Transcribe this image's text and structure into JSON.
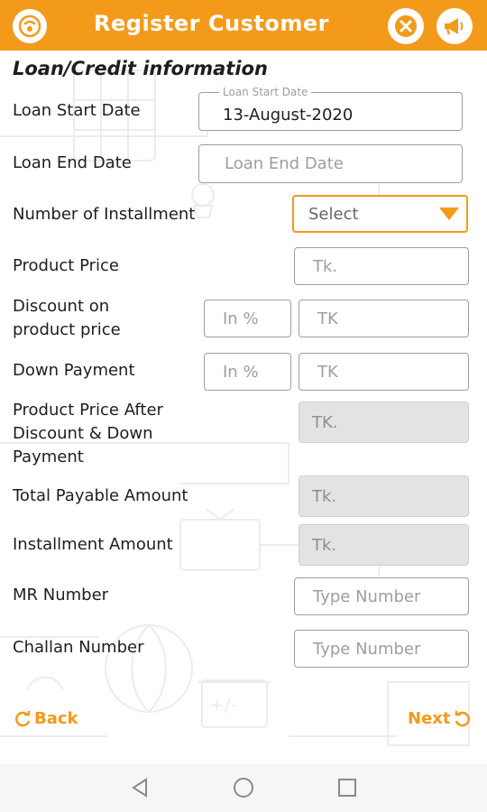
{
  "colors": {
    "accent": "#f39a1b",
    "readonly_bg": "#e3e3e3",
    "border": "#9e9e9e"
  },
  "header": {
    "title": "Register Customer",
    "logo_icon": "app-logo-icon",
    "close_icon": "close-icon",
    "announce_icon": "megaphone-icon"
  },
  "section": {
    "title": "Loan/Credit information"
  },
  "form": {
    "loan_start": {
      "label": "Loan Start Date",
      "legend": "Loan Start Date",
      "value": "13-August-2020"
    },
    "loan_end": {
      "label": "Loan End Date",
      "placeholder": "Loan End Date"
    },
    "installments": {
      "label": "Number of Installment",
      "selected": "Select"
    },
    "product_price": {
      "label": "Product Price",
      "placeholder": "Tk."
    },
    "discount": {
      "label_line1": "Discount on",
      "label_line2": "product price",
      "percent_placeholder": "In %",
      "amount_placeholder": "TK"
    },
    "down_payment": {
      "label": "Down Payment",
      "percent_placeholder": "In %",
      "amount_placeholder": "TK"
    },
    "price_after": {
      "label_line1": "Product Price After",
      "label_line2": "Discount & Down",
      "label_line3": "Payment",
      "placeholder": "TK."
    },
    "total_payable": {
      "label": "Total Payable Amount",
      "placeholder": "Tk."
    },
    "installment_amount": {
      "label": "Installment Amount",
      "placeholder": "Tk."
    },
    "mr_number": {
      "label": "MR Number",
      "placeholder": "Type Number"
    },
    "challan_number": {
      "label": "Challan Number",
      "placeholder": "Type Number"
    }
  },
  "navigation": {
    "back_label": "Back",
    "next_label": "Next"
  },
  "system_bar": {
    "back_icon": "triangle-back-icon",
    "home_icon": "circle-home-icon",
    "recents_icon": "square-recents-icon"
  }
}
